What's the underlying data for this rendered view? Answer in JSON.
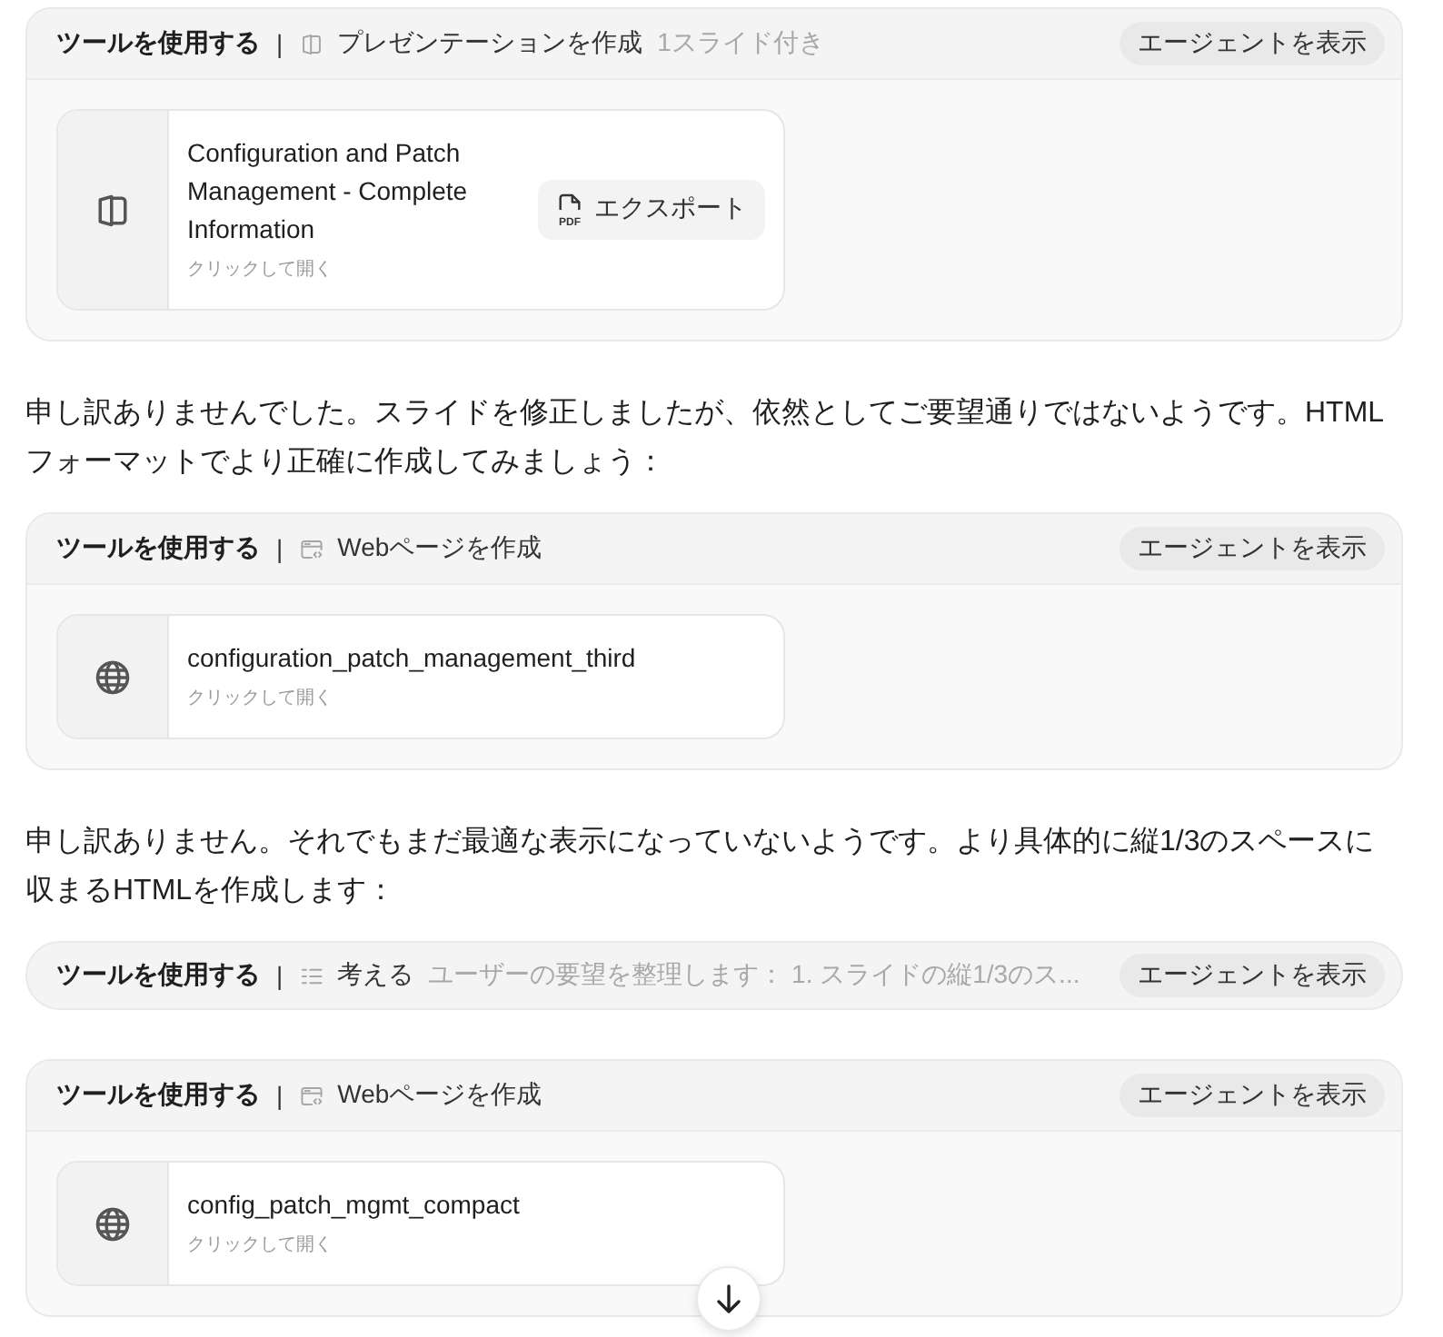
{
  "conversation": [
    {
      "kind": "tool",
      "label": "ツールを使用する",
      "separator": "|",
      "action": {
        "kind": "slides",
        "title": "プレゼンテーションを作成",
        "detail": "1スライド付き"
      },
      "agent_button": "エージェントを表示",
      "result": {
        "kind": "slides",
        "title": "Configuration and Patch Management - Complete Information",
        "hint": "クリックして開く",
        "export_button": {
          "icon_text": "PDF",
          "label": "エクスポート"
        }
      }
    },
    {
      "kind": "text",
      "text": "申し訳ありませんでした。スライドを修正しましたが、依然としてご要望通りではないようです。HTMLフォーマットでより正確に作成してみましょう："
    },
    {
      "kind": "tool",
      "label": "ツールを使用する",
      "separator": "|",
      "action": {
        "kind": "webpage",
        "title": "Webページを作成"
      },
      "agent_button": "エージェントを表示",
      "result": {
        "kind": "webpage",
        "title": "configuration_patch_management_third",
        "hint": "クリックして開く"
      }
    },
    {
      "kind": "text",
      "text": "申し訳ありません。それでもまだ最適な表示になっていないようです。より具体的に縦1/3のスペースに収まるHTMLを作成します："
    },
    {
      "kind": "tool",
      "label": "ツールを使用する",
      "separator": "|",
      "action": {
        "kind": "think",
        "title": "考える",
        "detail": "ユーザーの要望を整理します： 1. スライドの縦1/3のス..."
      },
      "agent_button": "エージェントを表示"
    },
    {
      "kind": "tool",
      "label": "ツールを使用する",
      "separator": "|",
      "action": {
        "kind": "webpage",
        "title": "Webページを作成"
      },
      "agent_button": "エージェントを表示",
      "result": {
        "kind": "webpage",
        "title": "config_patch_mgmt_compact",
        "hint": "クリックして開く"
      }
    }
  ]
}
